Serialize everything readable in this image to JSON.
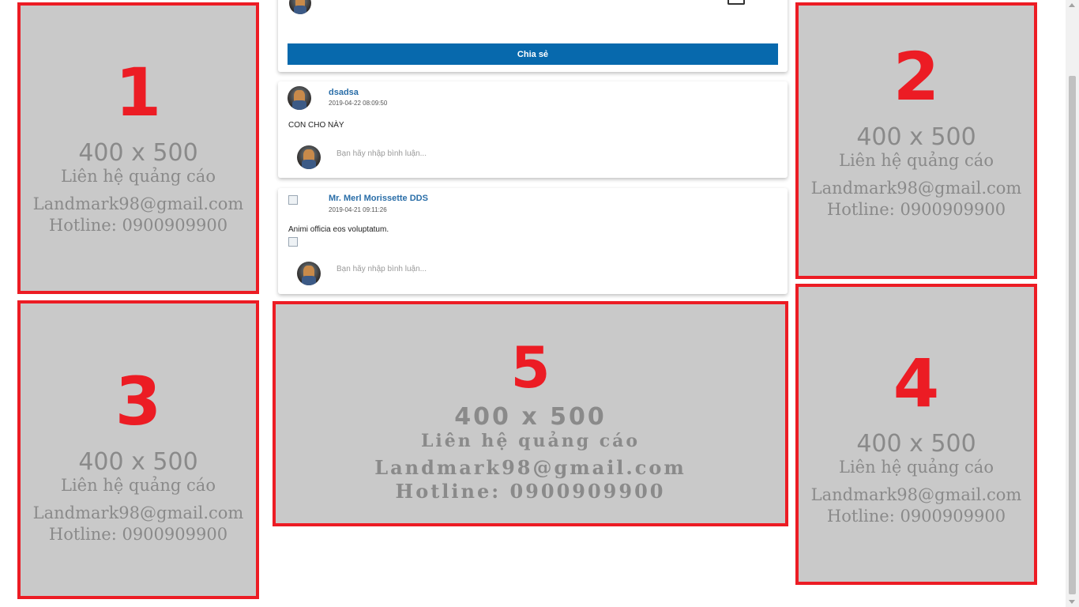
{
  "ads": [
    {
      "number": "1",
      "size": "400 x 500",
      "contact": "Liên hệ quảng cáo",
      "email": "Landmark98@gmail.com",
      "hotline": "Hotline: 0900909900"
    },
    {
      "number": "2",
      "size": "400 x 500",
      "contact": "Liên hệ quảng cáo",
      "email": "Landmark98@gmail.com",
      "hotline": "Hotline: 0900909900"
    },
    {
      "number": "3",
      "size": "400 x 500",
      "contact": "Liên hệ quảng cáo",
      "email": "Landmark98@gmail.com",
      "hotline": "Hotline: 0900909900"
    },
    {
      "number": "4",
      "size": "400 x 500",
      "contact": "Liên hệ quảng cáo",
      "email": "Landmark98@gmail.com",
      "hotline": "Hotline: 0900909900"
    },
    {
      "number": "5",
      "size": "400 x 500",
      "contact": "Liên hệ quảng cáo",
      "email": "Landmark98@gmail.com",
      "hotline": "Hotline: 0900909900"
    }
  ],
  "composer": {
    "share_label": "Chia sẻ"
  },
  "posts": [
    {
      "author": "dsadsa",
      "time": "2019-04-22 08:09:50",
      "content": "CON CHO NÀY",
      "comment_placeholder": "Bạn hãy nhập bình luận..."
    },
    {
      "author": "Mr. Merl Morissette DDS",
      "time": "2019-04-21 09:11:26",
      "content": "Animi officia eos voluptatum.",
      "comment_placeholder": "Bạn hãy nhập bình luận..."
    }
  ],
  "colors": {
    "ad_border": "#ec1c24",
    "ad_background": "#c9c9c9",
    "primary_button": "#0769ad",
    "author_link": "#2a6ea8"
  }
}
